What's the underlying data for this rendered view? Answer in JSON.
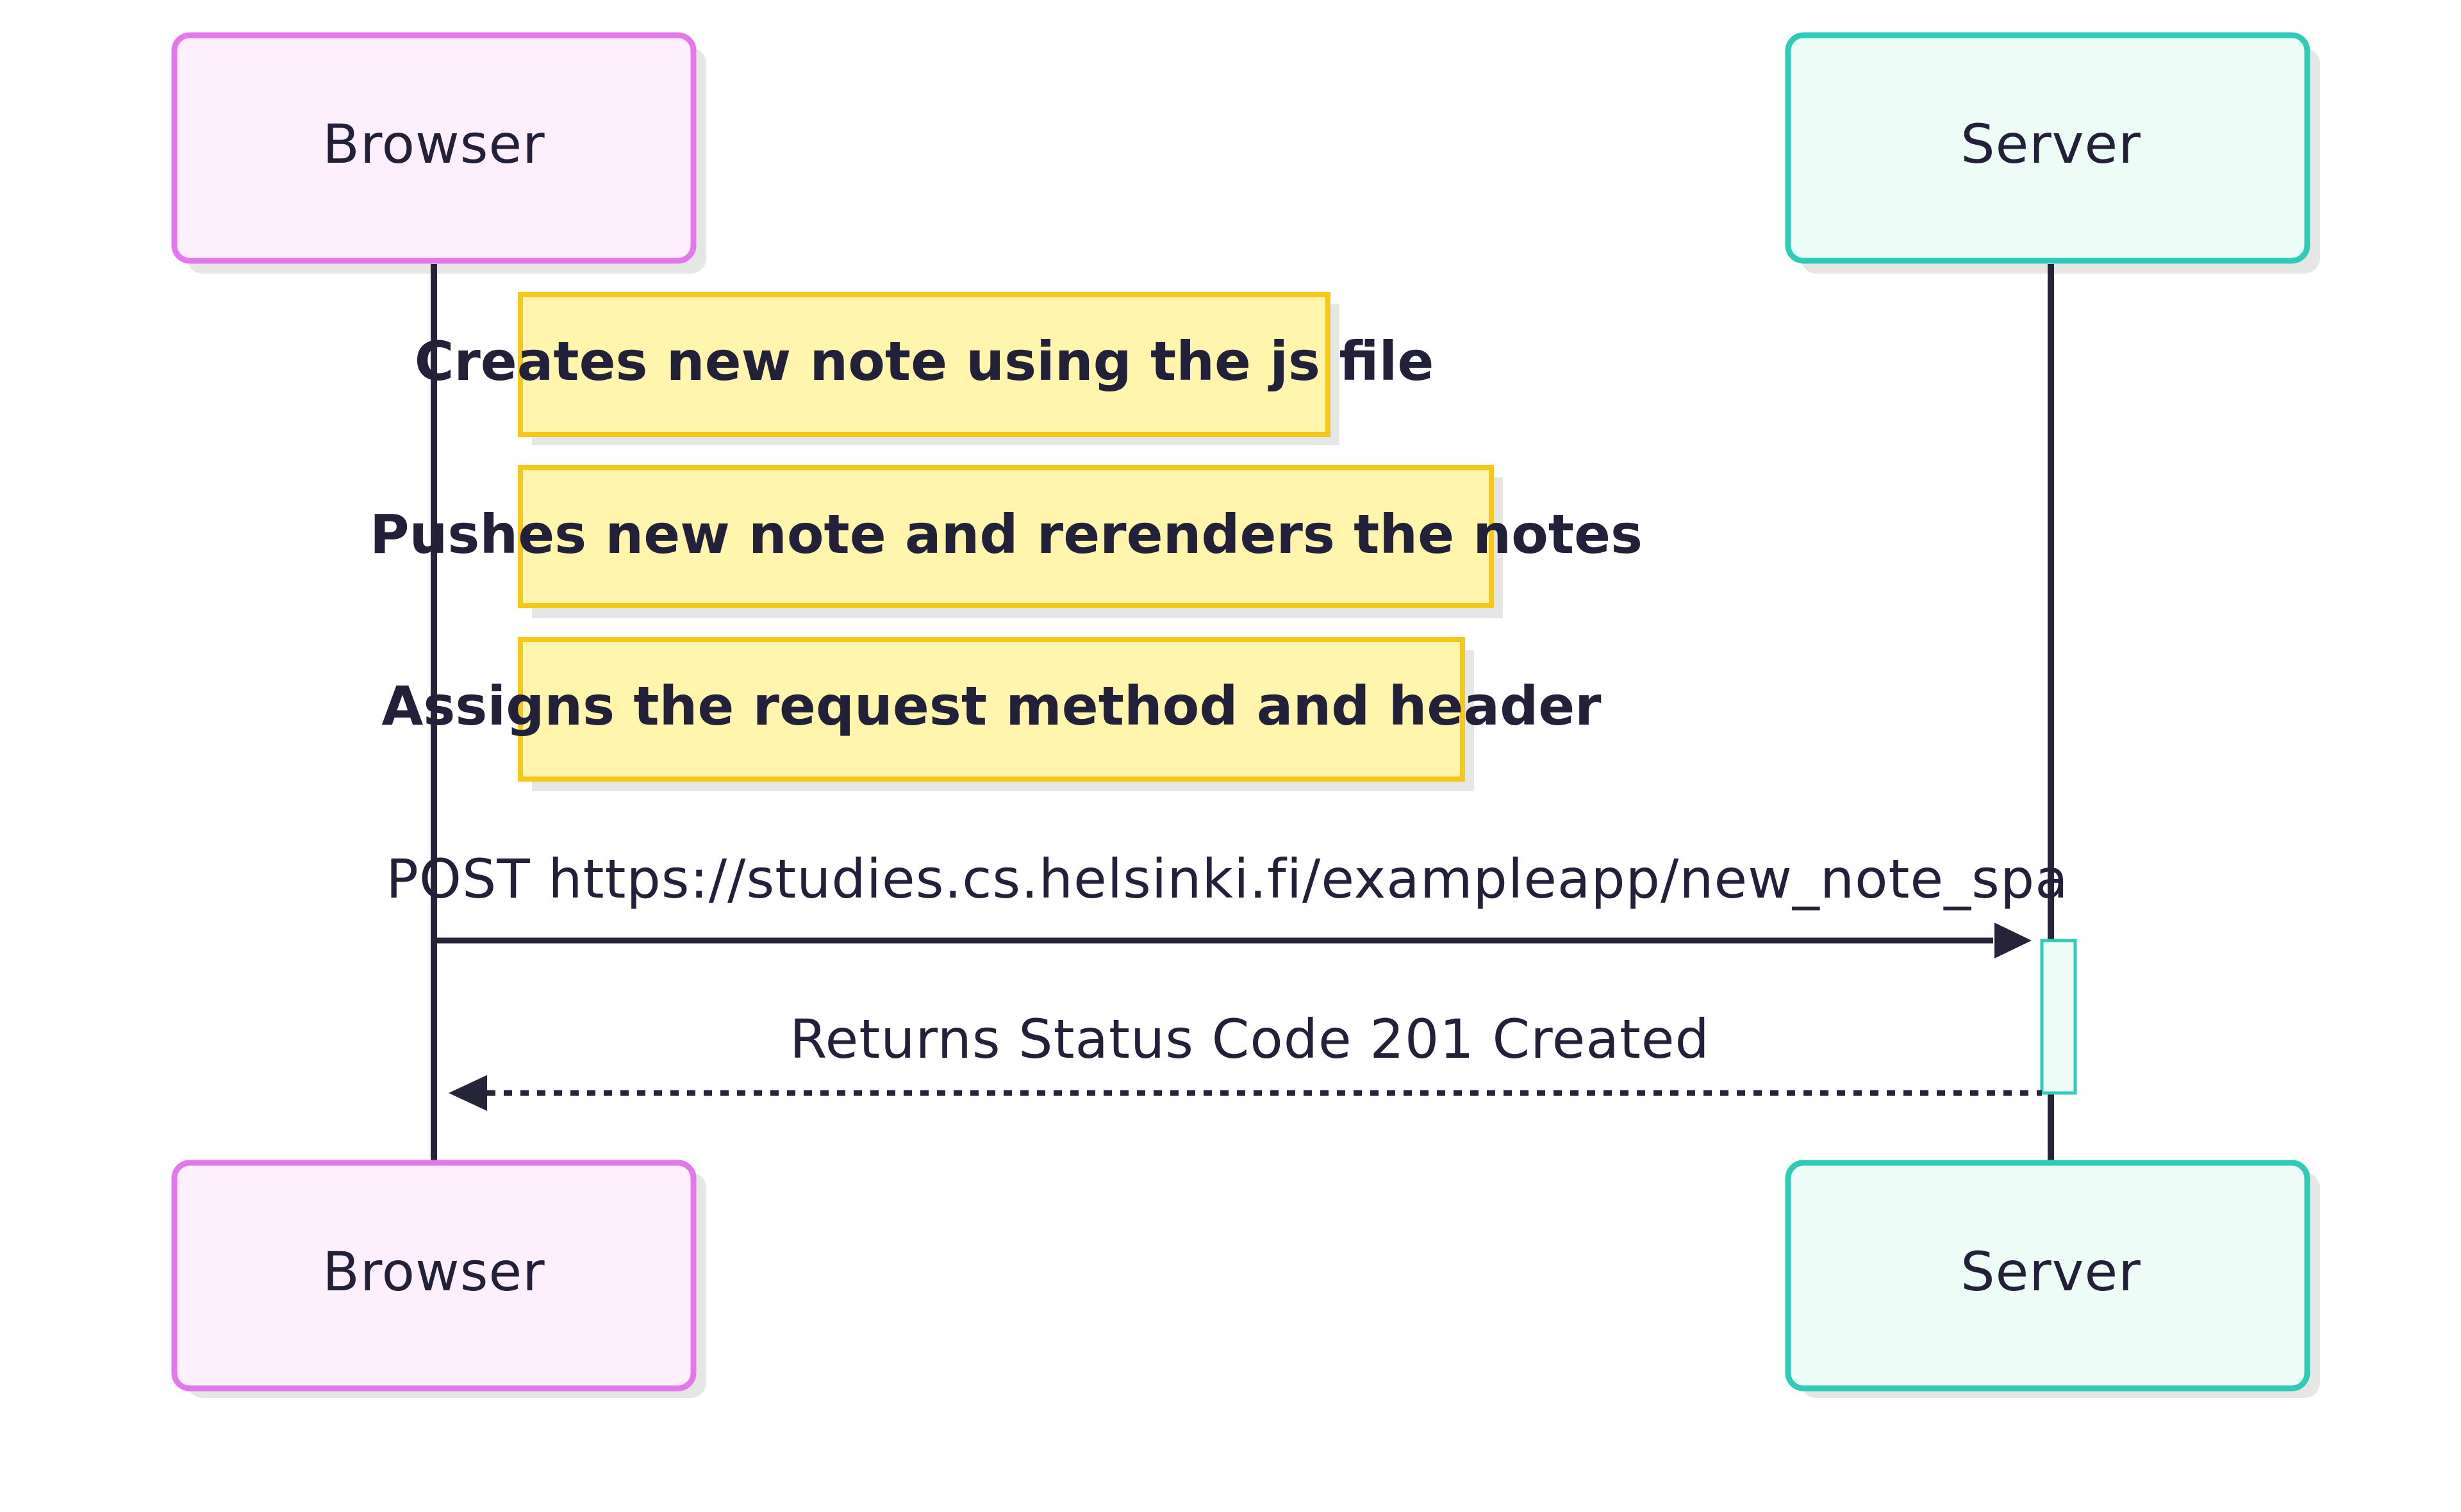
{
  "colors": {
    "browser_fill": "#fdf0fc",
    "browser_stroke": "#e378ec",
    "server_fill": "#eefcf8",
    "server_stroke": "#2ecbb8",
    "note_fill": "#fff5ad",
    "note_stroke": "#f5c81a",
    "line": "#26243a",
    "text": "#23213a",
    "shadow": "#e6e6e6"
  },
  "participants": {
    "browser": "Browser",
    "server": "Server"
  },
  "notes": [
    "Creates new note using the js file",
    "Pushes new note and rerenders the notes",
    "Assigns the request method and header"
  ],
  "messages": {
    "request": "POST https://studies.cs.helsinki.fi/exampleapp/new_note_spa",
    "response": "Returns Status Code 201 Created"
  }
}
